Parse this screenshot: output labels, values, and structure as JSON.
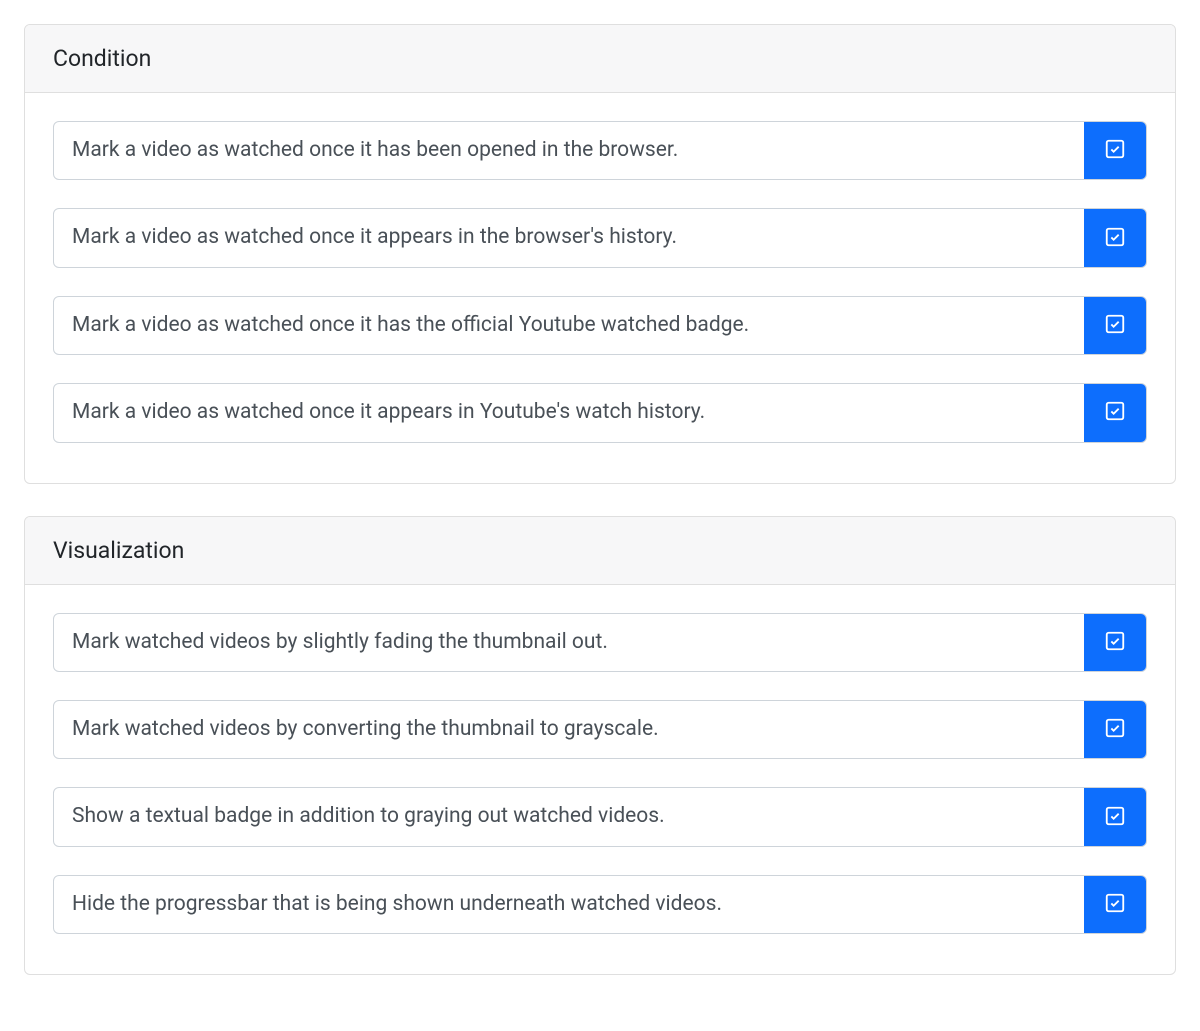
{
  "colors": {
    "primary": "#0d6efd",
    "border": "#ced4da",
    "text": "#495057",
    "headerBg": "#f7f7f8"
  },
  "sections": [
    {
      "title": "Condition",
      "items": [
        {
          "label": "Mark a video as watched once it has been opened in the browser.",
          "checked": true
        },
        {
          "label": "Mark a video as watched once it appears in the browser's history.",
          "checked": true
        },
        {
          "label": "Mark a video as watched once it has the official Youtube watched badge.",
          "checked": true
        },
        {
          "label": "Mark a video as watched once it appears in Youtube's watch history.",
          "checked": true
        }
      ]
    },
    {
      "title": "Visualization",
      "items": [
        {
          "label": "Mark watched videos by slightly fading the thumbnail out.",
          "checked": true
        },
        {
          "label": "Mark watched videos by converting the thumbnail to grayscale.",
          "checked": true
        },
        {
          "label": "Show a textual badge in addition to graying out watched videos.",
          "checked": true
        },
        {
          "label": "Hide the progressbar that is being shown underneath watched videos.",
          "checked": true
        }
      ]
    }
  ]
}
